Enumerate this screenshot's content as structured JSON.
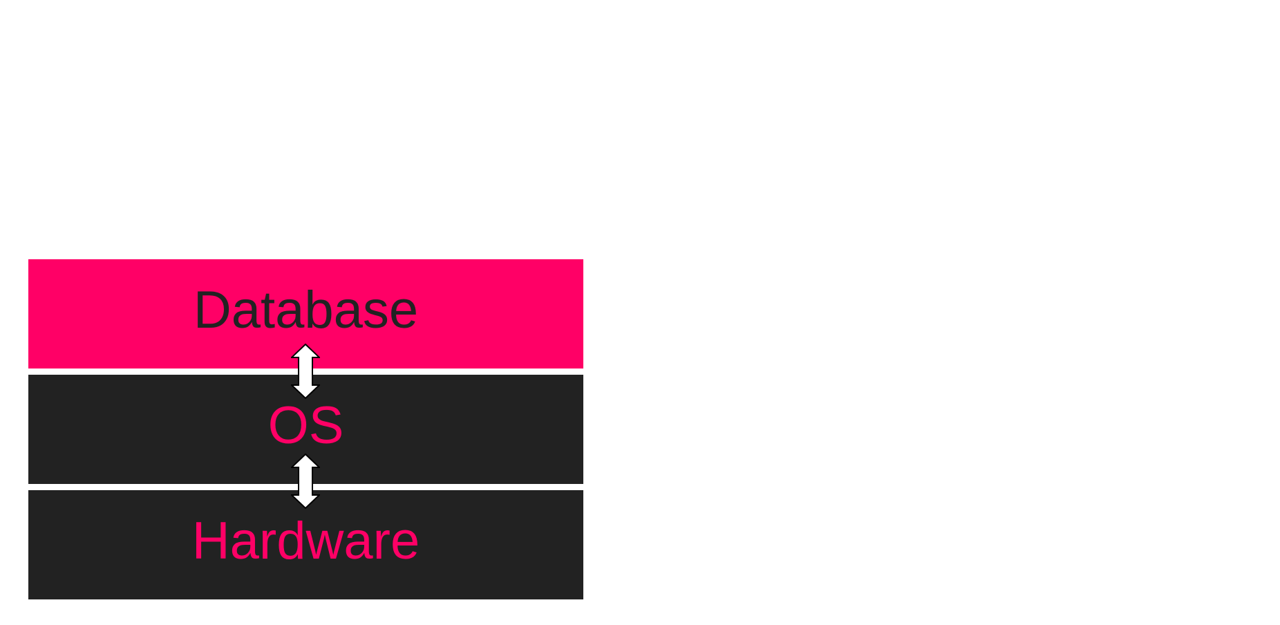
{
  "colors": {
    "accent": "#ff0066",
    "dark": "#222222",
    "arrow_fill": "#ffffff",
    "arrow_stroke": "#000000"
  },
  "layers": [
    {
      "label": "Database",
      "background": "#ff0066",
      "text_color": "#222222"
    },
    {
      "label": "OS",
      "background": "#222222",
      "text_color": "#ff0066"
    },
    {
      "label": "Hardware",
      "background": "#222222",
      "text_color": "#ff0066"
    }
  ],
  "arrows": [
    {
      "icon": "double-headed-arrow-icon",
      "between": [
        "Database",
        "OS"
      ]
    },
    {
      "icon": "double-headed-arrow-icon",
      "between": [
        "OS",
        "Hardware"
      ]
    }
  ]
}
